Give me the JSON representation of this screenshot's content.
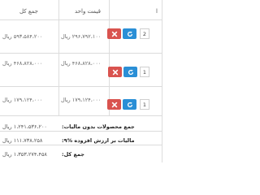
{
  "table": {
    "headers": {
      "total": "جمع کل",
      "unit_price": "قیمت واحد",
      "edge": "ا"
    },
    "rows": [
      {
        "total": "۵۹۳،۵۸۴،۲۰۰ ریال",
        "unit_price": "۲۹۶،۷۹۲،۱۰۰ ریال",
        "quantity": "2"
      },
      {
        "total": "۴۶۸،۸۲۸،۰۰۰ ریال",
        "unit_price": "۴۶۸،۸۲۸،۰۰۰ ریال",
        "quantity": "1"
      },
      {
        "total": "۱۷۹،۱۲۴،۰۰۰ ریال",
        "unit_price": "۱۷۹،۱۲۴،۰۰۰ ریال",
        "quantity": "1"
      }
    ]
  },
  "summary": {
    "subtotal_label": "جمع محصولات بدون مالیات:",
    "subtotal_value": "۱،۲۴۱،۵۳۶،۲۰۰ ریال",
    "vat_label": "مالیات بر ارزش افزوده %۹:",
    "vat_value": "۱۱۱،۷۳۸،۲۵۸ ریال",
    "grand_total_label": "جمع کل:",
    "grand_total_value": "۱،۳۵۳،۲۷۴،۴۵۸ ریال"
  },
  "colors": {
    "delete_button": "#d9534f",
    "refresh_button": "#2a8fd6"
  },
  "icons": {
    "delete": "close-icon",
    "refresh": "refresh-icon"
  }
}
